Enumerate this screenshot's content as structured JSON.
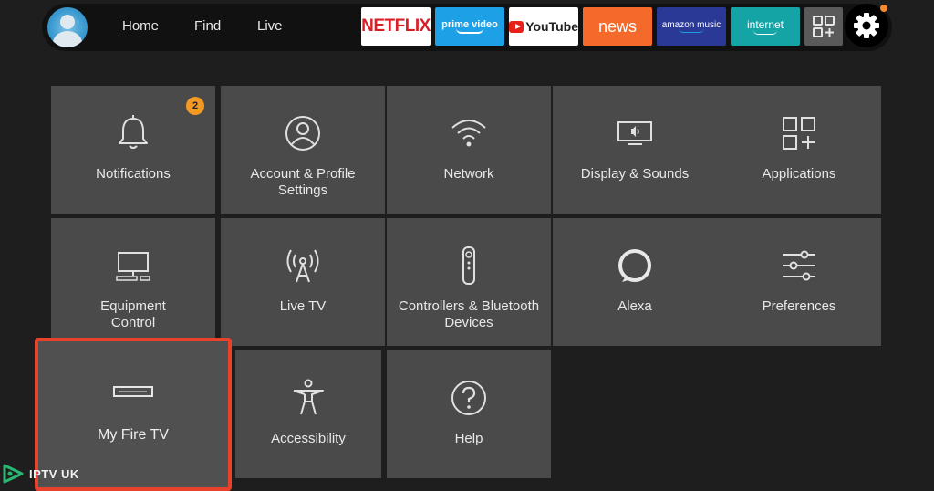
{
  "topbar": {
    "nav": [
      "Home",
      "Find",
      "Live"
    ],
    "tiles": {
      "netflix": "NETFLIX",
      "prime": "prime video",
      "youtube": "YouTube",
      "news": "news",
      "music": "amazon music",
      "internet": "internet"
    },
    "notification_dot_color": "#f78a2a"
  },
  "settings": {
    "notification_count": "2",
    "items": [
      {
        "label": "Notifications",
        "icon": "bell-icon"
      },
      {
        "label": "Account & Profile\nSettings",
        "icon": "user-circle-icon"
      },
      {
        "label": "Network",
        "icon": "wifi-icon"
      },
      {
        "label": "Display & Sounds",
        "icon": "display-sound-icon"
      },
      {
        "label": "Applications",
        "icon": "apps-grid-icon"
      },
      {
        "label": "Equipment\nControl",
        "icon": "monitor-icon"
      },
      {
        "label": "Live TV",
        "icon": "antenna-icon"
      },
      {
        "label": "Controllers & Bluetooth\nDevices",
        "icon": "remote-icon"
      },
      {
        "label": "Alexa",
        "icon": "alexa-icon"
      },
      {
        "label": "Preferences",
        "icon": "sliders-icon"
      },
      {
        "label": "My Fire TV",
        "icon": "fire-tv-device-icon"
      },
      {
        "label": "Accessibility",
        "icon": "accessibility-icon"
      },
      {
        "label": "Help",
        "icon": "help-icon"
      }
    ]
  },
  "highlight_color": "#e8412c",
  "watermark": "IPTV UK"
}
